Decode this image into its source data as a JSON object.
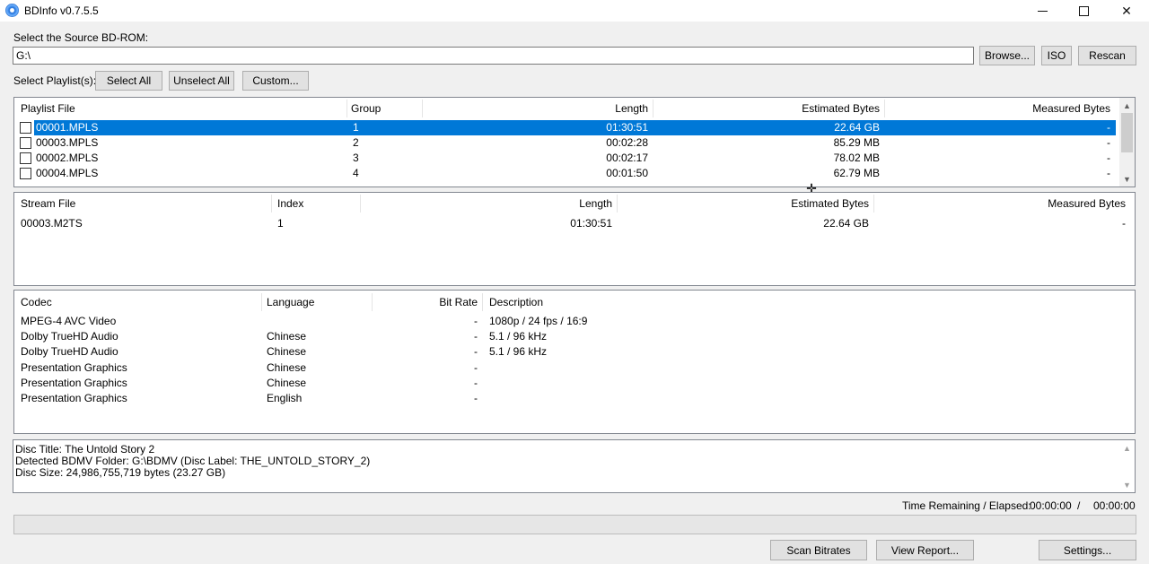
{
  "window": {
    "title": "BDInfo v0.7.5.5"
  },
  "source": {
    "label": "Select the Source BD-ROM:",
    "path": "G:\\",
    "browse": "Browse...",
    "iso": "ISO",
    "rescan": "Rescan"
  },
  "playlist_select": {
    "label": "Select Playlist(s):",
    "select_all": "Select All",
    "unselect_all": "Unselect All",
    "custom": "Custom..."
  },
  "playlists": {
    "columns": [
      "Playlist File",
      "Group",
      "Length",
      "Estimated Bytes",
      "Measured Bytes"
    ],
    "rows": [
      {
        "file": "00001.MPLS",
        "group": "1",
        "length": "01:30:51",
        "est": "22.64 GB",
        "measured": "-",
        "selected": true
      },
      {
        "file": "00003.MPLS",
        "group": "2",
        "length": "00:02:28",
        "est": "85.29 MB",
        "measured": "-",
        "selected": false
      },
      {
        "file": "00002.MPLS",
        "group": "3",
        "length": "00:02:17",
        "est": "78.02 MB",
        "measured": "-",
        "selected": false
      },
      {
        "file": "00004.MPLS",
        "group": "4",
        "length": "00:01:50",
        "est": "62.79 MB",
        "measured": "-",
        "selected": false
      }
    ]
  },
  "streams": {
    "columns": [
      "Stream File",
      "Index",
      "Length",
      "Estimated Bytes",
      "Measured Bytes"
    ],
    "rows": [
      {
        "file": "00003.M2TS",
        "index": "1",
        "length": "01:30:51",
        "est": "22.64 GB",
        "measured": "-"
      }
    ]
  },
  "codecs": {
    "columns": [
      "Codec",
      "Language",
      "Bit Rate",
      "Description"
    ],
    "rows": [
      {
        "codec": "MPEG-4 AVC Video",
        "language": "",
        "bitrate": "-",
        "description": "1080p / 24 fps / 16:9"
      },
      {
        "codec": "Dolby TrueHD Audio",
        "language": "Chinese",
        "bitrate": "-",
        "description": "5.1 / 96 kHz"
      },
      {
        "codec": "Dolby TrueHD Audio",
        "language": "Chinese",
        "bitrate": "-",
        "description": "5.1 / 96 kHz"
      },
      {
        "codec": "Presentation Graphics",
        "language": "Chinese",
        "bitrate": "-",
        "description": ""
      },
      {
        "codec": "Presentation Graphics",
        "language": "Chinese",
        "bitrate": "-",
        "description": ""
      },
      {
        "codec": "Presentation Graphics",
        "language": "English",
        "bitrate": "-",
        "description": ""
      }
    ]
  },
  "report": {
    "lines": [
      "Disc Title: The Untold Story 2",
      "Detected BDMV Folder: G:\\BDMV (Disc Label: THE_UNTOLD_STORY_2)",
      "Disc Size: 24,986,755,719 bytes (23.27 GB)"
    ]
  },
  "status": {
    "time_label": "Time Remaining / Elapsed:",
    "remaining": "00:00:00",
    "separator": "/",
    "elapsed": "00:00:00",
    "progress": 0
  },
  "footer": {
    "scan": "Scan Bitrates",
    "view_report": "View Report...",
    "settings": "Settings..."
  },
  "colors": {
    "selection": "#0078d7",
    "window_bg": "#f0f0f0"
  }
}
